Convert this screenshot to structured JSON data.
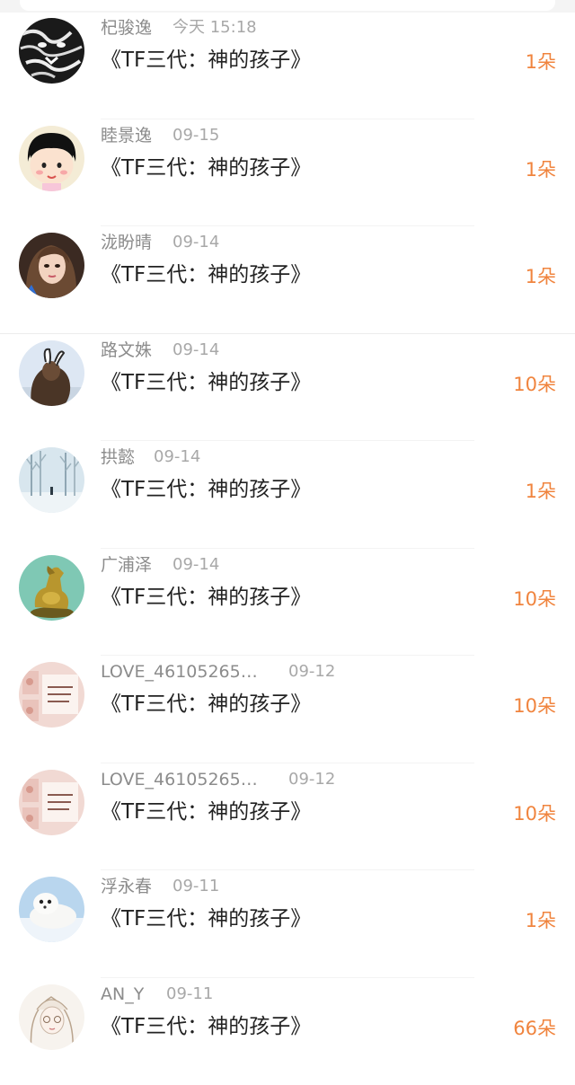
{
  "accent_color": "#f0843e",
  "rows": [
    {
      "name": "杞骏逸",
      "time": "今天 15:18",
      "title": "《TF三代：神的孩子》",
      "count": "1朵",
      "avatar_icon": "tiger-avatar-icon"
    },
    {
      "name": "睦景逸",
      "time": "09-15",
      "title": "《TF三代：神的孩子》",
      "count": "1朵",
      "avatar_icon": "cartoon-girl-avatar-icon"
    },
    {
      "name": "泷盼晴",
      "time": "09-14",
      "title": "《TF三代：神的孩子》",
      "count": "1朵",
      "avatar_icon": "woman-selfie-avatar-icon"
    },
    {
      "name": "路文姝",
      "time": "09-14",
      "title": "《TF三代：神的孩子》",
      "count": "10朵",
      "avatar_icon": "bunny-ear-girl-avatar-icon"
    },
    {
      "name": "拱懿",
      "time": "09-14",
      "title": "《TF三代：神的孩子》",
      "count": "1朵",
      "avatar_icon": "winter-trees-avatar-icon"
    },
    {
      "name": "广浦泽",
      "time": "09-14",
      "title": "《TF三代：神的孩子》",
      "count": "10朵",
      "avatar_icon": "golden-horse-avatar-icon"
    },
    {
      "name": "LOVE_46105265…",
      "time": "09-12",
      "title": "《TF三代：神的孩子》",
      "count": "10朵",
      "avatar_icon": "pink-note-avatar-icon"
    },
    {
      "name": "LOVE_46105265…",
      "time": "09-12",
      "title": "《TF三代：神的孩子》",
      "count": "10朵",
      "avatar_icon": "pink-note-avatar-icon"
    },
    {
      "name": "浮永春",
      "time": "09-11",
      "title": "《TF三代：神的孩子》",
      "count": "1朵",
      "avatar_icon": "seal-pup-avatar-icon"
    },
    {
      "name": "AN_Y",
      "time": "09-11",
      "title": "《TF三代：神的孩子》",
      "count": "66朵",
      "avatar_icon": "anime-girl-avatar-icon"
    }
  ]
}
